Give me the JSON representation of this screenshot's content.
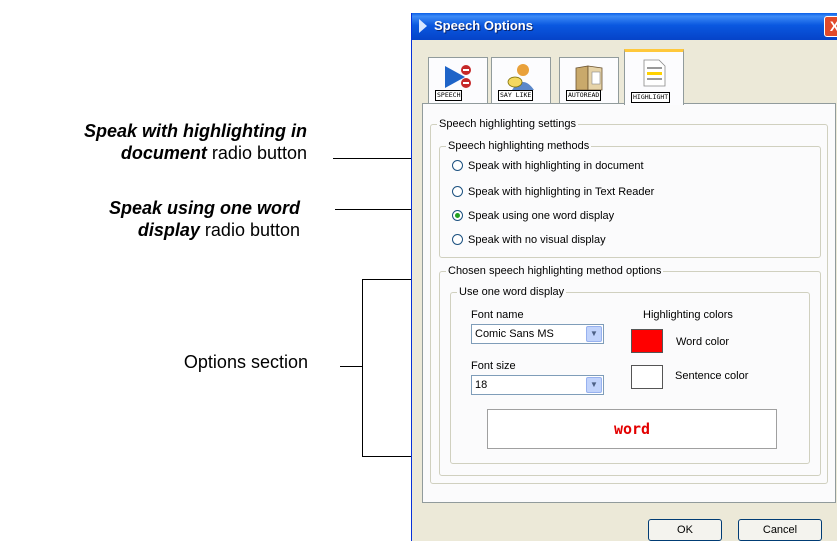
{
  "callouts": {
    "highlight_doc": {
      "bold": "Speak with highlighting in",
      "bold2": "document",
      "rest": " radio button"
    },
    "one_word": {
      "bold": "Speak using one word",
      "bold2": "display",
      "rest": " radio button"
    },
    "options": "Options section"
  },
  "dialog": {
    "title": "Speech Options",
    "close": "X",
    "tabs": [
      {
        "label": "SPEECH",
        "icon": "speech-play-icon"
      },
      {
        "label": "SAY LIKE",
        "icon": "say-like-person-icon"
      },
      {
        "label": "AUTOREAD",
        "icon": "autoread-book-icon"
      },
      {
        "label": "HIGHLIGHT",
        "icon": "highlight-document-icon"
      }
    ],
    "settings_group": "Speech highlighting settings",
    "methods_group": "Speech highlighting methods",
    "methods": [
      "Speak with highlighting in document",
      "Speak with highlighting in Text Reader",
      "Speak using one word display",
      "Speak with no visual display"
    ],
    "selected_method_index": 2,
    "options_group": "Chosen speech highlighting method options",
    "one_word_group": "Use one word display",
    "font_name_label": "Font name",
    "font_name_value": "Comic Sans MS",
    "font_size_label": "Font size",
    "font_size_value": "18",
    "colors_label": "Highlighting colors",
    "word_color_label": "Word color",
    "sentence_color_label": "Sentence color",
    "word_color": "#ff0000",
    "sentence_color": "#ffffff",
    "preview_word": "word",
    "ok": "OK",
    "cancel": "Cancel"
  }
}
